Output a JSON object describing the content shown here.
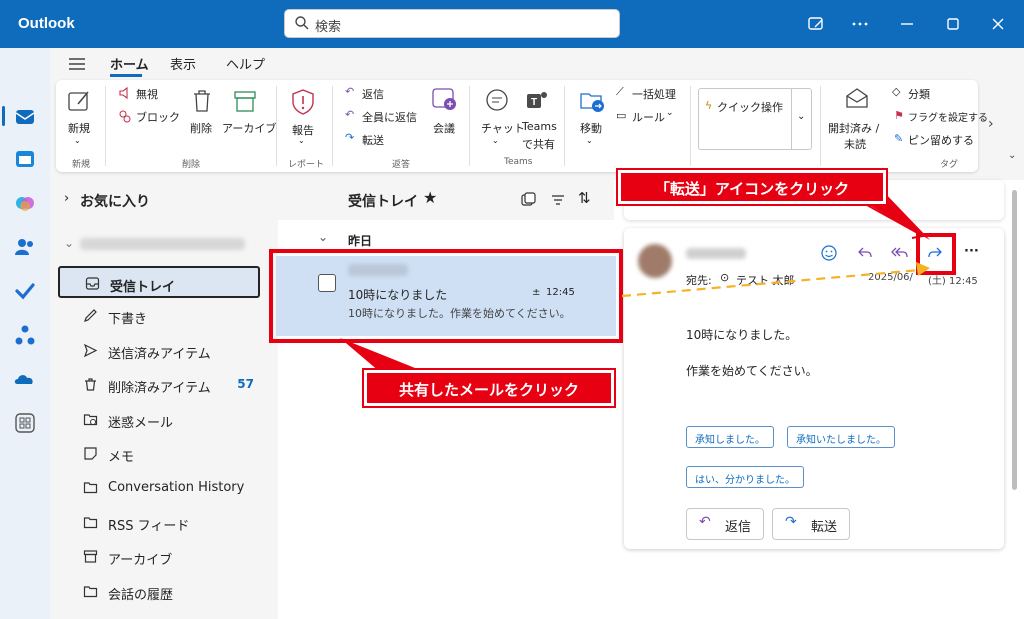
{
  "titlebar": {
    "app_title": "Outlook",
    "search_placeholder": "検索"
  },
  "ribbon_tabs": [
    "ホーム",
    "表示",
    "ヘルプ"
  ],
  "ribbon": {
    "new_label": "新規",
    "new_group": "新規",
    "ignore": "無視",
    "block": "ブロック",
    "delete": "削除",
    "archive": "アーカイブ",
    "delete_group": "削除",
    "report": "報告",
    "report_group": "レポート",
    "reply": "返信",
    "reply_all": "全員に返信",
    "forward": "転送",
    "meeting": "会議",
    "respond_group": "返答",
    "chat": "チャット",
    "teams_share": "Teams で共有",
    "teams_share_line1": "Teams",
    "teams_share_line2": "で共有",
    "teams_group": "Teams",
    "move": "移動",
    "sweep": "一括処理",
    "rules": "ルール",
    "quick_steps": "クイック操作",
    "read_unread": "開封済み / 未読",
    "read_unread_line1": "開封済み /",
    "read_unread_line2": "未読",
    "categorize": "分類",
    "flag": "フラグを設定する",
    "pin": "ピン留めする",
    "tags_group": "タグ"
  },
  "nav": {
    "favorites": "お気に入り",
    "folders": [
      {
        "label": "受信トレイ",
        "icon": "inbox-icon",
        "count": ""
      },
      {
        "label": "下書き",
        "icon": "draft-icon",
        "count": ""
      },
      {
        "label": "送信済みアイテム",
        "icon": "send-icon",
        "count": ""
      },
      {
        "label": "削除済みアイテム",
        "icon": "trash-icon",
        "count": "57"
      },
      {
        "label": "迷惑メール",
        "icon": "junk-icon",
        "count": ""
      },
      {
        "label": "メモ",
        "icon": "note-icon",
        "count": ""
      },
      {
        "label": "Conversation History",
        "icon": "folder-icon",
        "count": ""
      },
      {
        "label": "RSS フィード",
        "icon": "folder-icon",
        "count": ""
      },
      {
        "label": "アーカイブ",
        "icon": "archive-icon",
        "count": ""
      },
      {
        "label": "会話の履歴",
        "icon": "folder-icon",
        "count": ""
      }
    ]
  },
  "list": {
    "title": "受信トレイ",
    "date_group": "昨日",
    "item": {
      "subject": "10時になりました",
      "time": "12:45",
      "preview": "10時になりました。作業を始めてください。"
    }
  },
  "reading": {
    "to_label": "宛先:",
    "to_name": "テスト 太郎",
    "date": "2025/06/",
    "date_tail": "(土) 12:45",
    "body_line1": "10時になりました。",
    "body_line2": "作業を始めてください。",
    "suggestions": [
      "承知しました。",
      "承知いたしました。",
      "はい、分かりました。"
    ],
    "reply_button": "返信",
    "forward_button": "転送"
  },
  "annotations": {
    "forward_callout": "「転送」アイコンをクリック",
    "mail_callout": "共有したメールをクリック"
  },
  "colors": {
    "accent": "#0f6cbd",
    "highlight_red": "#e60012",
    "selection": "#cfe0f5",
    "arrow": "#f5b324"
  }
}
